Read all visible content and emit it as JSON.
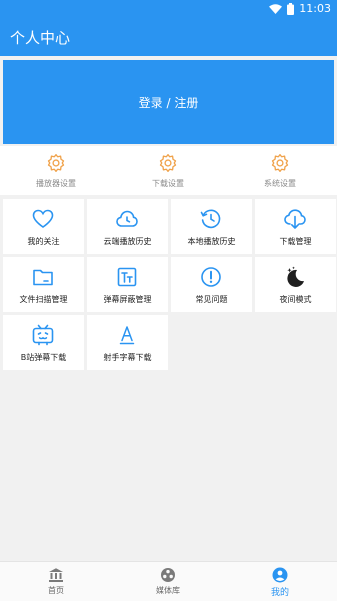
{
  "status_bar": {
    "time": "11:03"
  },
  "app_bar": {
    "title": "个人中心"
  },
  "login": {
    "label": "登录 / 注册"
  },
  "settings": [
    {
      "label": "播放器设置",
      "icon": "gear-icon"
    },
    {
      "label": "下载设置",
      "icon": "gear-icon"
    },
    {
      "label": "系统设置",
      "icon": "gear-icon"
    }
  ],
  "tiles": [
    {
      "label": "我的关注",
      "icon": "heart-icon"
    },
    {
      "label": "云端播放历史",
      "icon": "cloud-clock-icon"
    },
    {
      "label": "本地播放历史",
      "icon": "history-icon"
    },
    {
      "label": "下载管理",
      "icon": "cloud-download-icon"
    },
    {
      "label": "文件扫描管理",
      "icon": "folder-icon"
    },
    {
      "label": "弹幕屏蔽管理",
      "icon": "text-box-icon"
    },
    {
      "label": "常见问题",
      "icon": "alert-circle-icon"
    },
    {
      "label": "夜间模式",
      "icon": "moon-icon"
    },
    {
      "label": "B站弹幕下载",
      "icon": "bilibili-tv-icon"
    },
    {
      "label": "射手字幕下载",
      "icon": "letter-a-icon"
    }
  ],
  "bottom_nav": [
    {
      "label": "首页",
      "icon": "bank-icon"
    },
    {
      "label": "媒体库",
      "icon": "film-reel-icon"
    },
    {
      "label": "我的",
      "icon": "account-circle-icon",
      "active": true
    }
  ],
  "colors": {
    "primary": "#2a94f1",
    "setting_icon": "#f0a24a",
    "icon_blue": "#2a94f1"
  }
}
